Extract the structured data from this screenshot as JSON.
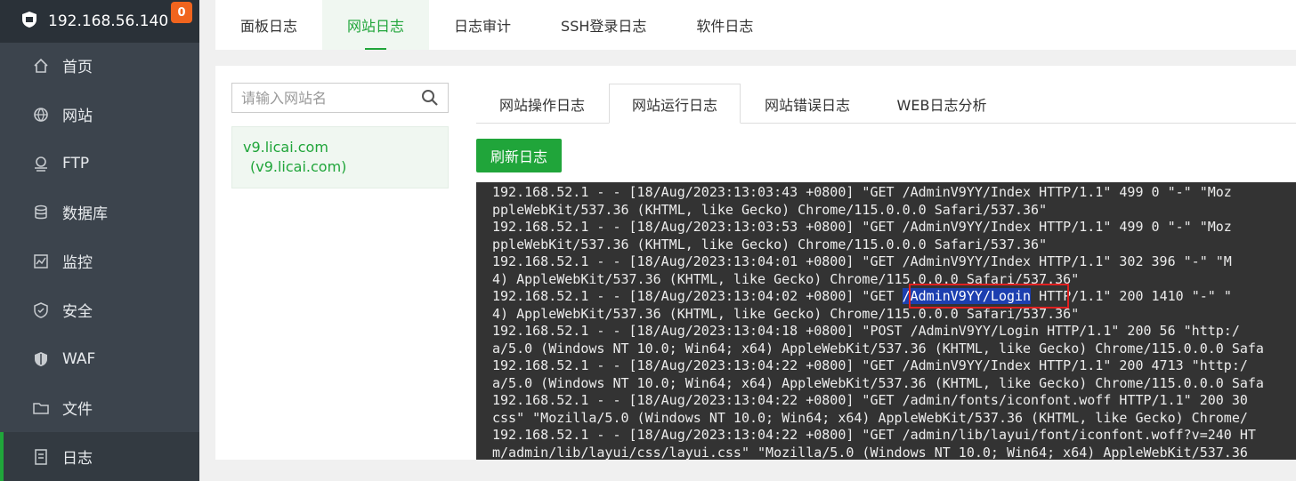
{
  "sidebar": {
    "host": "192.168.56.140",
    "badge": "0",
    "items": [
      {
        "label": "首页",
        "icon": "home-icon"
      },
      {
        "label": "网站",
        "icon": "globe-icon"
      },
      {
        "label": "FTP",
        "icon": "ftp-icon"
      },
      {
        "label": "数据库",
        "icon": "database-icon"
      },
      {
        "label": "监控",
        "icon": "monitor-icon"
      },
      {
        "label": "安全",
        "icon": "shield-icon"
      },
      {
        "label": "WAF",
        "icon": "waf-shield-icon"
      },
      {
        "label": "文件",
        "icon": "folder-icon"
      },
      {
        "label": "日志",
        "icon": "log-icon"
      }
    ]
  },
  "top_tabs": [
    "面板日志",
    "网站日志",
    "日志审计",
    "SSH登录日志",
    "软件日志"
  ],
  "top_tabs_active": "网站日志",
  "search": {
    "placeholder": "请输入网站名"
  },
  "site": {
    "name": "v9.licai.com",
    "alias": "(v9.licai.com)"
  },
  "sub_tabs": [
    "网站操作日志",
    "网站运行日志",
    "网站错误日志",
    "WEB日志分析"
  ],
  "sub_tabs_active": "网站运行日志",
  "refresh_label": "刷新日志",
  "log": {
    "line_00": "192.168.52.1 - - [18/Aug/2023:13:03:43 +0800] \"GET /AdminV9YY/Index HTTP/1.1\" 499 0 \"-\" \"Moz",
    "line_01": "ppleWebKit/537.36 (KHTML, like Gecko) Chrome/115.0.0.0 Safari/537.36\"",
    "line_02": "192.168.52.1 - - [18/Aug/2023:13:03:53 +0800] \"GET /AdminV9YY/Index HTTP/1.1\" 499 0 \"-\" \"Moz",
    "line_03": "ppleWebKit/537.36 (KHTML, like Gecko) Chrome/115.0.0.0 Safari/537.36\"",
    "line_04": "192.168.52.1 - - [18/Aug/2023:13:04:01 +0800] \"GET /AdminV9YY/Index HTTP/1.1\" 302 396 \"-\" \"M",
    "line_05": "4) AppleWebKit/537.36 (KHTML, like Gecko) Chrome/115.0.0.0 Safari/537.36\"",
    "line_06_pre": "192.168.52.1 - - [18/Aug/2023:13:04:02 +0800] \"GET ",
    "line_06_hl": "/AdminV9YY/Login",
    "line_06_post": " HTTP/1.1\" 200 1410 \"-\" \"",
    "line_07": "4) AppleWebKit/537.36 (KHTML, like Gecko) Chrome/115.0.0.0 Safari/537.36\"",
    "line_08": "192.168.52.1 - - [18/Aug/2023:13:04:18 +0800] \"POST /AdminV9YY/Login HTTP/1.1\" 200 56 \"http:/",
    "line_09": "a/5.0 (Windows NT 10.0; Win64; x64) AppleWebKit/537.36 (KHTML, like Gecko) Chrome/115.0.0.0 Safa",
    "line_10": "192.168.52.1 - - [18/Aug/2023:13:04:22 +0800] \"GET /AdminV9YY/Index HTTP/1.1\" 200 4713 \"http:/",
    "line_11": "a/5.0 (Windows NT 10.0; Win64; x64) AppleWebKit/537.36 (KHTML, like Gecko) Chrome/115.0.0.0 Safa",
    "line_12": "192.168.52.1 - - [18/Aug/2023:13:04:22 +0800] \"GET /admin/fonts/iconfont.woff HTTP/1.1\" 200 30",
    "line_13": "css\" \"Mozilla/5.0 (Windows NT 10.0; Win64; x64) AppleWebKit/537.36 (KHTML, like Gecko) Chrome/",
    "line_14": "192.168.52.1 - - [18/Aug/2023:13:04:22 +0800] \"GET /admin/lib/layui/font/iconfont.woff?v=240 HT",
    "line_15": "m/admin/lib/layui/css/layui.css\" \"Mozilla/5.0 (Windows NT 10.0; Win64; x64) AppleWebKit/537.36"
  },
  "colors": {
    "accent": "#20a53a",
    "sidebar": "#3c444d",
    "log_bg": "#333333",
    "highlight": "#1c3fb0",
    "annotation": "#e02020"
  }
}
